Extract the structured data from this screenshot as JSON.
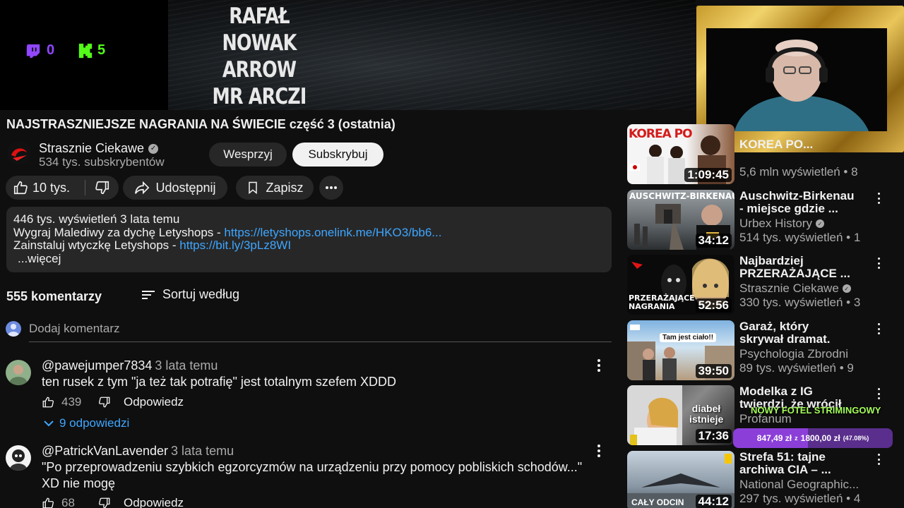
{
  "stream_overlay": {
    "banner_names": [
      "RAFAŁ NOWAK",
      "ARROW",
      "MR ARCZI"
    ],
    "twitch_count": "0",
    "kick_count": "5",
    "colors": {
      "twitch": "#9146ff",
      "kick": "#53fc18"
    }
  },
  "video": {
    "title": "NAJSTRASZNIEJSZE NAGRANIA NA ŚWIECIE część 3 (ostatnia)",
    "channel_name": "Strasznie Ciekawe",
    "channel_subs": "534 tys. subskrybentów",
    "support_label": "Wesprzyj",
    "subscribe_label": "Subskrybuj",
    "likes": "10 tys.",
    "share_label": "Udostępnij",
    "save_label": "Zapisz"
  },
  "description": {
    "views_time": "446 tys. wyświetleń  3 lata temu",
    "line1_text": "Wygraj Malediwy za dychę Letyshops - ",
    "line1_link": "https://letyshops.onelink.me/HKO3/bb6...",
    "line2_text": "Zainstaluj wtyczkę Letyshops - ",
    "line2_link": "https://bit.ly/3pLz8WI",
    "more_label": "...więcej"
  },
  "comments": {
    "count_label": "555 komentarzy",
    "sort_label": "Sortuj według",
    "add_placeholder": "Dodaj komentarz",
    "items": [
      {
        "author": "@pawejumper7834",
        "time": "3 lata temu",
        "text": "ten rusek z tym \"ja też tak potrafię\" jest totalnym szefem XDDD",
        "likes": "439",
        "reply_label": "Odpowiedz",
        "replies_label": "9 odpowiedzi"
      },
      {
        "author": "@PatrickVanLavender",
        "time": "3 lata temu",
        "text": "\"Po przeprowadzeniu szybkich egzorcyzmów na urządzeniu przy pomocy pobliskich schodów...\" XD nie mogę",
        "likes": "68",
        "reply_label": "Odpowiedz"
      }
    ]
  },
  "sidebar": [
    {
      "title": "KOREA PO...",
      "channel": "",
      "meta": "5,6 mln wyświetleń • 8",
      "duration": "1:09:45",
      "thumb_text": "KOREA PO"
    },
    {
      "title": "Auschwitz-Birkenau\n- miejsce gdzie ...",
      "channel": "Urbex History",
      "meta": "514 tys. wyświetleń • 1",
      "duration": "34:12",
      "thumb_text": "AUSCHWITZ-BIRKENAU"
    },
    {
      "title": "Najbardziej\nPRZERAŻAJĄCE ...",
      "channel": "Strasznie Ciekawe",
      "meta": "330 tys. wyświetleń • 3",
      "duration": "52:56",
      "thumb_text": "PRZERAŻAJĄCE NAGRANIA"
    },
    {
      "title": "Garaż, który\nskrywał dramat.",
      "channel": "Psychologia Zbrodni",
      "meta": "89 tys. wyświetleń • 9",
      "duration": "39:50",
      "thumb_text": "Tam jest ciało!!"
    },
    {
      "title": "Modelka z IG\ntwierdzi, że wrócił",
      "channel": "Profanum",
      "meta": "",
      "duration": "17:36",
      "thumb_text": "diabeł istnieje"
    },
    {
      "title": "Strefa 51: tajne\narchiwa CIA – ...",
      "channel": "National Geographic...",
      "meta": "297 tys. wyświetleń • 4",
      "duration": "44:12",
      "thumb_text": "CAŁY ODCIN"
    }
  ],
  "donation": {
    "title": "NOWY FOTEL STRIMINGOWY",
    "current": "847,49 zł",
    "separator": "z",
    "goal": "1800,00 zł",
    "percent_label": "(47.08%)",
    "progress_fraction": 0.4708
  }
}
